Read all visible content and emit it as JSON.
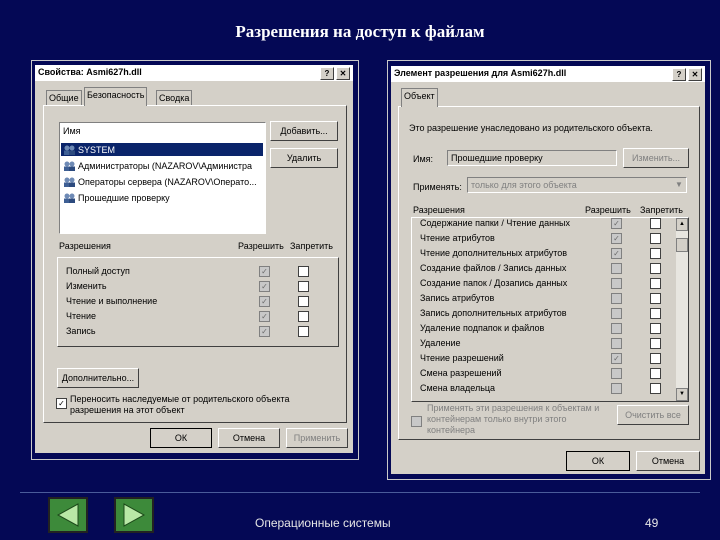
{
  "slide": {
    "title": "Разрешения на доступ к  файлам",
    "footer": "Операционные системы",
    "page_number": "49"
  },
  "left_dialog": {
    "title": "Свойства: Asmi627h.dll",
    "tabs": [
      "Общие",
      "Безопасность",
      "Сводка"
    ],
    "names_header": "Имя",
    "users": [
      "SYSTEM",
      "Администраторы (NAZAROV\\Администра",
      "Операторы сервера (NAZAROV\\Операто...",
      "Прошедшие проверку"
    ],
    "add_button": "Добавить...",
    "remove_button": "Удалить",
    "permissions_header": "Разрешения",
    "allow_header": "Разрешить",
    "deny_header": "Запретить",
    "permissions": [
      "Полный доступ",
      "Изменить",
      "Чтение и выполнение",
      "Чтение",
      "Запись"
    ],
    "advanced_button": "Дополнительно...",
    "inherit_text": "Переносить наследуемые от родительского объекта разрешения на этот объект",
    "ok": "ОК",
    "cancel": "Отмена",
    "apply": "Применить"
  },
  "right_dialog": {
    "title": "Элемент разрешения для Asmi627h.dll",
    "tab": "Объект",
    "inherited_note": "Это разрешение унаследовано из родительского объекта.",
    "name_label": "Имя:",
    "name_value": "Прошедшие проверку",
    "change_button": "Изменить...",
    "apply_to_label": "Применять:",
    "apply_to_value": "только для этого объекта",
    "permissions_header": "Разрешения",
    "allow_header": "Разрешить",
    "deny_header": "Запретить",
    "permissions": [
      "Содержание папки / Чтение данных",
      "Чтение атрибутов",
      "Чтение дополнительных атрибутов",
      "Создание файлов / Запись данных",
      "Создание папок / Дозапись данных",
      "Запись атрибутов",
      "Запись дополнительных атрибутов",
      "Удаление подпапок и файлов",
      "Удаление",
      "Чтение разрешений",
      "Смена разрешений",
      "Смена владельца"
    ],
    "apply_children_text": "Применять эти разрешения к объектам и контейнерам только внутри этого контейнера",
    "clear_all_button": "Очистить все",
    "ok": "ОК",
    "cancel": "Отмена"
  }
}
